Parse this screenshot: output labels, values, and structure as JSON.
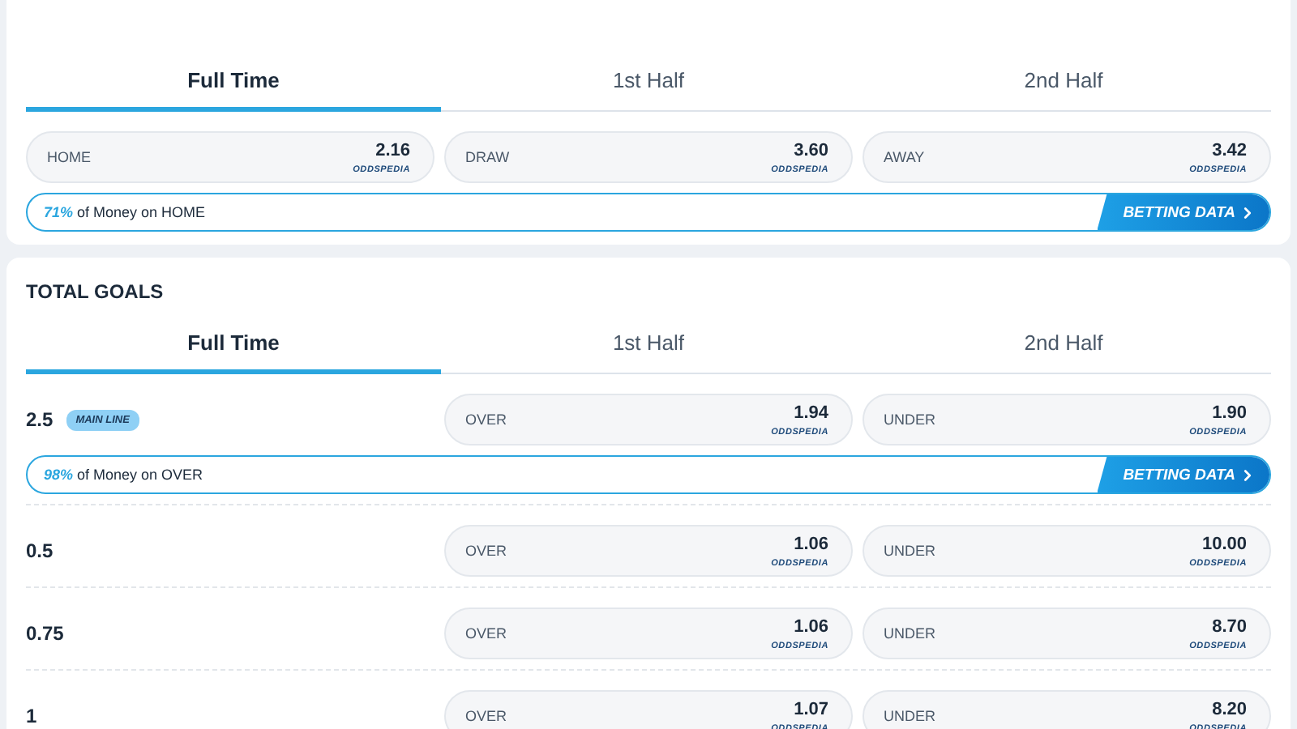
{
  "match_result": {
    "tabs": [
      {
        "label": "Full Time",
        "selected": true
      },
      {
        "label": "1st Half",
        "selected": false
      },
      {
        "label": "2nd Half",
        "selected": false
      }
    ],
    "odds": [
      {
        "label": "HOME",
        "price": "2.16",
        "brand": "ODDSPEDIA"
      },
      {
        "label": "DRAW",
        "price": "3.60",
        "brand": "ODDSPEDIA"
      },
      {
        "label": "AWAY",
        "price": "3.42",
        "brand": "ODDSPEDIA"
      }
    ],
    "money": {
      "percent": "71%",
      "text": "of Money on HOME",
      "button": "BETTING DATA"
    }
  },
  "total_goals": {
    "title": "TOTAL GOALS",
    "tabs": [
      {
        "label": "Full Time",
        "selected": true
      },
      {
        "label": "1st Half",
        "selected": false
      },
      {
        "label": "2nd Half",
        "selected": false
      }
    ],
    "lines": [
      {
        "line": "2.5",
        "badge": "MAIN LINE",
        "odds": [
          {
            "label": "OVER",
            "price": "1.94",
            "brand": "ODDSPEDIA"
          },
          {
            "label": "UNDER",
            "price": "1.90",
            "brand": "ODDSPEDIA"
          }
        ],
        "money": {
          "percent": "98%",
          "text": "of Money on OVER",
          "button": "BETTING DATA"
        }
      },
      {
        "line": "0.5",
        "odds": [
          {
            "label": "OVER",
            "price": "1.06",
            "brand": "ODDSPEDIA"
          },
          {
            "label": "UNDER",
            "price": "10.00",
            "brand": "ODDSPEDIA"
          }
        ]
      },
      {
        "line": "0.75",
        "odds": [
          {
            "label": "OVER",
            "price": "1.06",
            "brand": "ODDSPEDIA"
          },
          {
            "label": "UNDER",
            "price": "8.70",
            "brand": "ODDSPEDIA"
          }
        ]
      },
      {
        "line": "1",
        "odds": [
          {
            "label": "OVER",
            "price": "1.07",
            "brand": "ODDSPEDIA"
          },
          {
            "label": "UNDER",
            "price": "8.20",
            "brand": "ODDSPEDIA"
          }
        ]
      }
    ]
  }
}
